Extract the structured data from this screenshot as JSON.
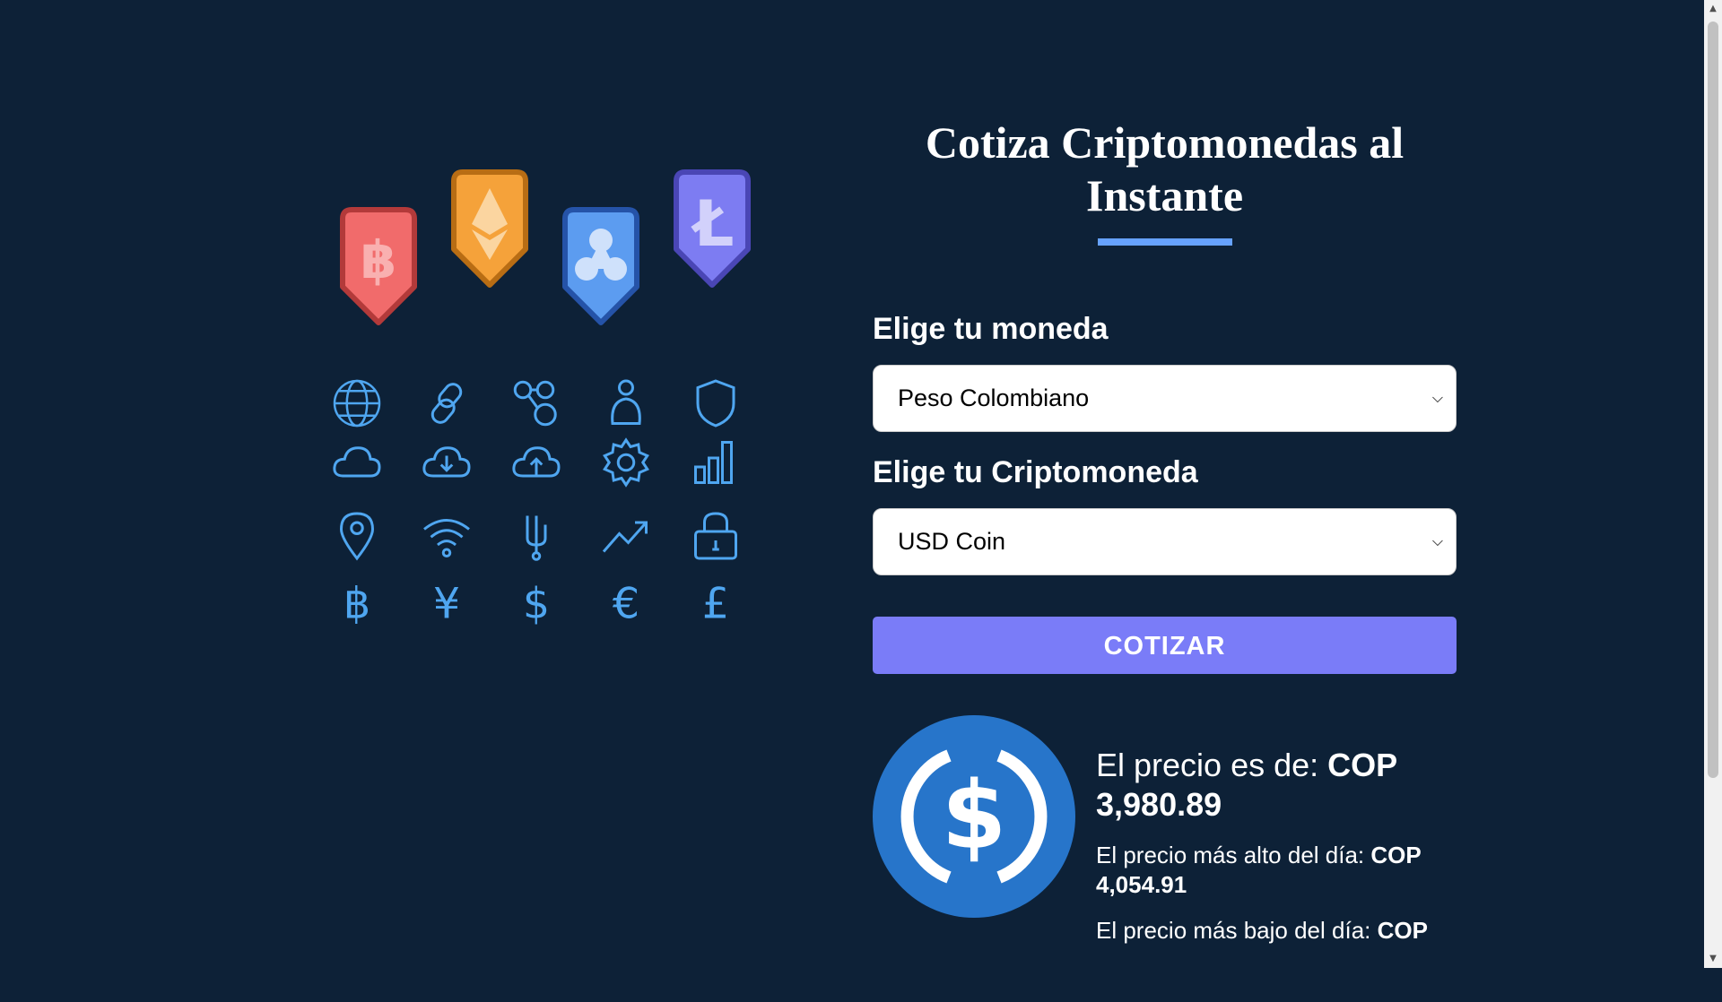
{
  "title": "Cotiza Criptomonedas al Instante",
  "currency_field": {
    "label": "Elige tu moneda",
    "selected": "Peso Colombiano"
  },
  "crypto_field": {
    "label": "Elige tu Criptomoneda",
    "selected": "USD Coin"
  },
  "submit_label": "COTIZAR",
  "result": {
    "price_label": "El precio es de:",
    "price_value": "COP 3,980.89",
    "high_label": "El precio más alto del día:",
    "high_value": "COP 4,054.91",
    "low_label": "El precio más bajo del día:",
    "low_value": "COP"
  },
  "badges": [
    "bitcoin-badge-icon",
    "ethereum-badge-icon",
    "ripple-badge-icon",
    "litecoin-badge-icon"
  ],
  "colors": {
    "background": "#0d2137",
    "accent": "#7a7cf8",
    "underline": "#66a2fe",
    "icon_stroke": "#4fa6f0",
    "usdc_blue": "#2775ca"
  }
}
